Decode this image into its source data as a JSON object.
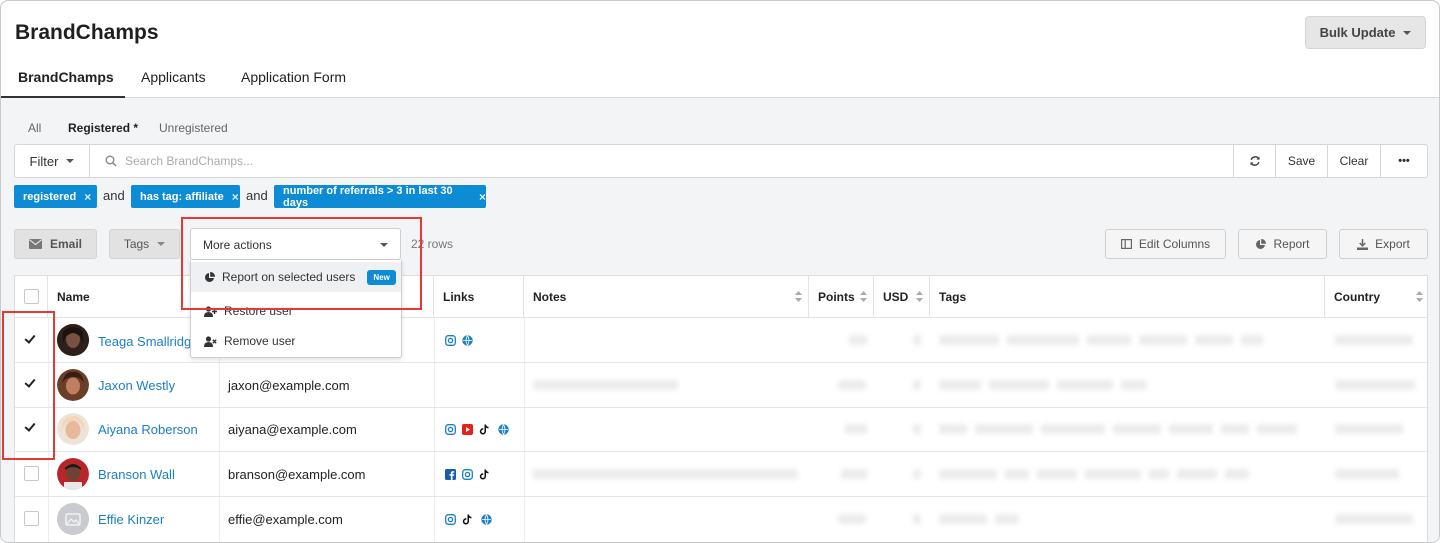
{
  "app": {
    "title": "BrandChamps",
    "bulk_update_label": "Bulk Update"
  },
  "main_tabs": [
    {
      "label": "BrandChamps",
      "active": true
    },
    {
      "label": "Applicants",
      "active": false
    },
    {
      "label": "Application Form",
      "active": false
    }
  ],
  "sub_tabs": [
    {
      "label": "All",
      "active": false
    },
    {
      "label": "Registered *",
      "active": true
    },
    {
      "label": "Unregistered",
      "active": false
    }
  ],
  "filter_bar": {
    "filter_label": "Filter",
    "search_placeholder": "Search BrandChamps...",
    "save_label": "Save",
    "clear_label": "Clear",
    "more_label": "•••"
  },
  "filter_chips": [
    {
      "label": "registered",
      "close": "×"
    },
    {
      "label": "has tag: affiliate",
      "close": "×"
    },
    {
      "label": "number of referrals > 3 in last 30 days",
      "close": "×"
    }
  ],
  "conjunction": "and",
  "actions": {
    "email_label": "Email",
    "tags_label": "Tags",
    "more_actions_label": "More actions",
    "rows_count": "22 rows",
    "edit_columns_label": "Edit Columns",
    "report_label": "Report",
    "export_label": "Export"
  },
  "more_actions_menu": [
    {
      "label": "Report on selected users",
      "badge": "New"
    },
    {
      "label": "Restore user"
    },
    {
      "label": "Remove user"
    }
  ],
  "table": {
    "columns": [
      "Name",
      "Links",
      "Notes",
      "Points",
      "USD",
      "Tags",
      "Country"
    ],
    "rows": [
      {
        "name": "Teaga  Smallridge",
        "email": "",
        "checked": true,
        "links": [
          "instagram",
          "web"
        ]
      },
      {
        "name": "Jaxon Westly",
        "email": "jaxon@example.com",
        "checked": true,
        "links": []
      },
      {
        "name": "Aiyana Roberson",
        "email": "aiyana@example.com",
        "checked": true,
        "links": [
          "instagram",
          "youtube",
          "tiktok",
          "web"
        ]
      },
      {
        "name": "Branson Wall",
        "email": "branson@example.com",
        "checked": false,
        "links": [
          "facebook",
          "instagram",
          "tiktok"
        ]
      },
      {
        "name": "Effie Kinzer",
        "email": "effie@example.com",
        "checked": false,
        "links": [
          "instagram",
          "tiktok",
          "web"
        ]
      }
    ]
  },
  "colors": {
    "accent": "#0d8bd4",
    "link": "#1a7fc4",
    "highlight": "#e53a34",
    "tiktok": "#111111",
    "youtube": "#e62117"
  }
}
